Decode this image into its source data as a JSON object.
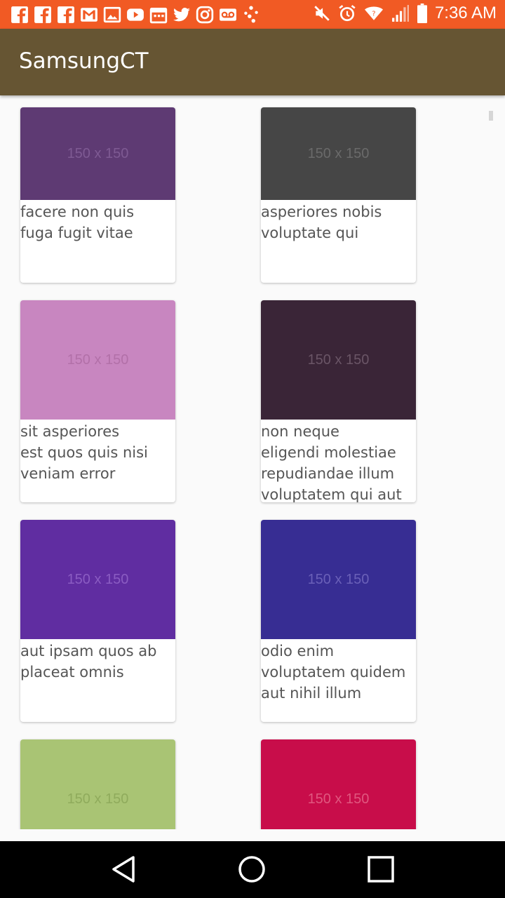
{
  "status_bar": {
    "time": "7:36 AM",
    "left_icons": [
      "facebook-icon",
      "facebook-icon",
      "facebook-icon",
      "gmail-icon",
      "gallery-icon",
      "youtube-icon",
      "calendar-icon",
      "twitter-icon",
      "instagram-icon",
      "voicemail-icon",
      "dots-icon"
    ],
    "right_icons": [
      "mute-icon",
      "alarm-icon",
      "wifi-icon",
      "signal-icon",
      "battery-icon"
    ]
  },
  "app_bar": {
    "title": "SamsungCT"
  },
  "cards": [
    {
      "image_label": "150 x 150",
      "color": "#5e3a73",
      "text": "facere non quis\nfuga fugit vitae"
    },
    {
      "image_label": "150 x 150",
      "color": "#464646",
      "text": "asperiores nobis\nvoluptate qui"
    },
    {
      "image_label": "150 x 150",
      "color": "#c886c0",
      "text": "sit asperiores\nest quos quis nisi\nveniam error"
    },
    {
      "image_label": "150 x 150",
      "color": "#3a2537",
      "text": "non neque\neligendi molestiae\nrepudiandae illum\nvoluptatem qui aut"
    },
    {
      "image_label": "150 x 150",
      "color": "#602da1",
      "text": "aut ipsam quos ab\nplaceat omnis"
    },
    {
      "image_label": "150 x 150",
      "color": "#372d93",
      "text": "odio enim\nvoluptatem quidem\naut nihil illum"
    },
    {
      "image_label": "150 x 150",
      "color": "#a9c474",
      "text": ""
    },
    {
      "image_label": "150 x 150",
      "color": "#c80d4a",
      "text": ""
    }
  ],
  "nav_bar": {
    "buttons": [
      "back-icon",
      "home-icon",
      "recents-icon"
    ]
  }
}
